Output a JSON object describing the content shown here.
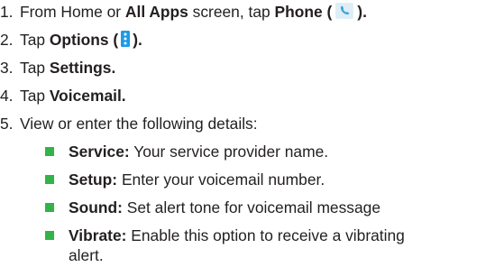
{
  "steps": [
    {
      "num": "1.",
      "parts": [
        "From Home or ",
        "All Apps",
        " screen, tap ",
        "Phone (",
        ")."
      ]
    },
    {
      "num": "2.",
      "parts": [
        "Tap ",
        "Options (",
        ")."
      ]
    },
    {
      "num": "3.",
      "parts": [
        "Tap ",
        "Settings."
      ]
    },
    {
      "num": "4.",
      "parts": [
        "Tap ",
        "Voicemail."
      ]
    },
    {
      "num": "5.",
      "parts": [
        "View or enter the following details:"
      ]
    }
  ],
  "details": [
    {
      "term": "Service:",
      "desc": " Your service provider name."
    },
    {
      "term": "Setup:",
      "desc": " Enter your voicemail number."
    },
    {
      "term": "Sound:",
      "desc": " Set alert tone for voicemail message"
    },
    {
      "term": "Vibrate:",
      "desc": " Enable this option to receive a vibrating",
      "desc_cont": "alert."
    }
  ],
  "icons": {
    "phone": "phone-app-icon",
    "options": "options-menu-icon"
  },
  "colors": {
    "text": "#231f20",
    "bullet": "#33b24a",
    "options_icon": "#1e9be6",
    "phone_icon_bg": "#dfeef6",
    "phone_icon_glyph": "#3aa3dc"
  }
}
